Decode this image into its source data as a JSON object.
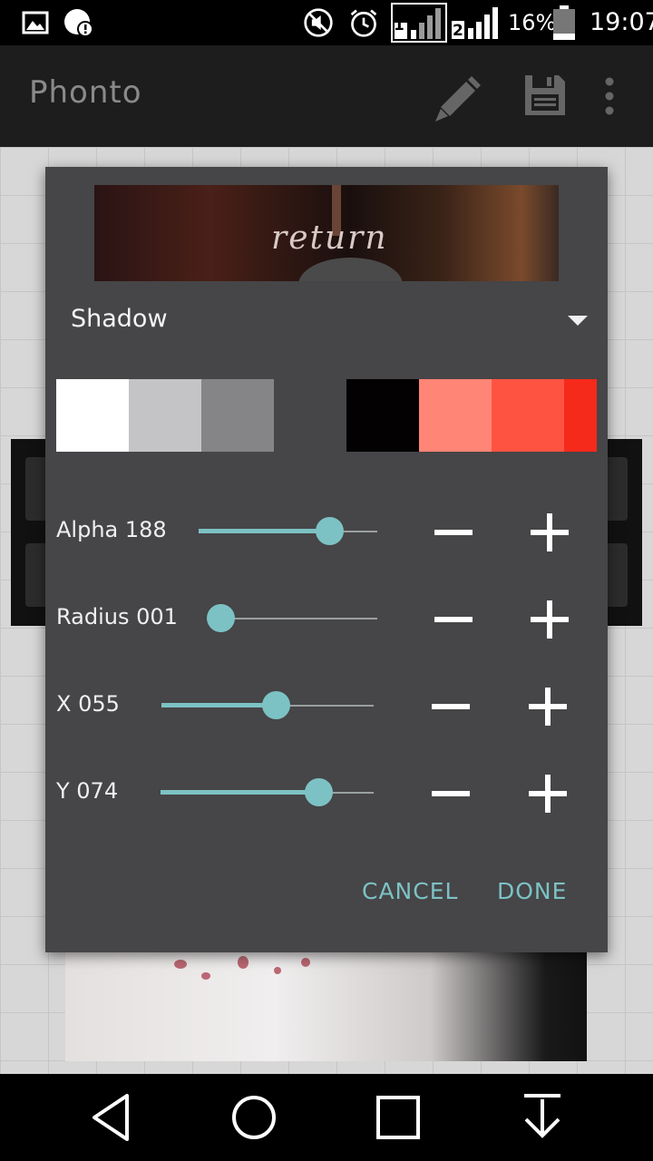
{
  "status_bar": {
    "icons": [
      "image-icon",
      "alert-icon",
      "mute-icon",
      "alarm-icon",
      "sim1-signal-icon",
      "sim2-signal-icon",
      "battery-icon"
    ],
    "sim1": "1",
    "sim2": "2",
    "battery_percent": "16%",
    "time": "19:07"
  },
  "app_bar": {
    "title": "Phonto",
    "actions": [
      "pencil-icon",
      "save-icon",
      "overflow-menu-icon"
    ]
  },
  "dialog": {
    "preview_text": "return",
    "effect_selector": {
      "selected": "Shadow"
    },
    "swatches": [
      "#ffffff",
      "#c4c3c5",
      "#858486",
      "#464547",
      "#030102",
      "#ff8576",
      "#ff5342",
      "#f52a1b"
    ],
    "sliders": [
      {
        "label": "Alpha 188",
        "value": 188,
        "max": 255,
        "fraction": 0.73
      },
      {
        "label": "Radius 001",
        "value": 1,
        "max": 100,
        "fraction": 0.01
      },
      {
        "label": "X 055",
        "value": 55,
        "max": 100,
        "fraction": 0.54
      },
      {
        "label": "Y 074",
        "value": 74,
        "max": 100,
        "fraction": 0.74
      }
    ],
    "cancel_label": "CANCEL",
    "done_label": "DONE"
  },
  "nav_bar": {
    "buttons": [
      "back-icon",
      "home-icon",
      "recents-icon",
      "hide-nav-icon"
    ]
  },
  "colors": {
    "accent": "#7cc2c4",
    "dialog_bg": "#464547",
    "app_bar_bg": "#1d1d1d"
  }
}
